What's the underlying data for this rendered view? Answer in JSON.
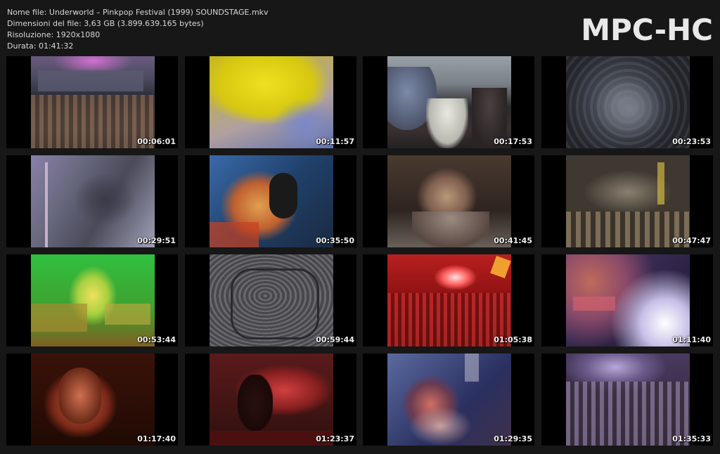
{
  "header": {
    "file_name": "Nome file: Underworld – Pinkpop Festival (1999) SOUNDSTAGE.mkv",
    "file_size": "Dimensioni del file: 3,63 GB (3.899.639.165 bytes)",
    "resolution": "Risoluzione: 1920x1080",
    "duration": "Durata: 01:41:32"
  },
  "logo": "MPC-HC",
  "thumbnails": [
    {
      "time": "00:06:01"
    },
    {
      "time": "00:11:57"
    },
    {
      "time": "00:17:53"
    },
    {
      "time": "00:23:53"
    },
    {
      "time": "00:29:51"
    },
    {
      "time": "00:35:50"
    },
    {
      "time": "00:41:45"
    },
    {
      "time": "00:47:47"
    },
    {
      "time": "00:53:44"
    },
    {
      "time": "00:59:44"
    },
    {
      "time": "01:05:38"
    },
    {
      "time": "01:11:40"
    },
    {
      "time": "01:17:40"
    },
    {
      "time": "01:23:37"
    },
    {
      "time": "01:29:35"
    },
    {
      "time": "01:35:33"
    }
  ]
}
